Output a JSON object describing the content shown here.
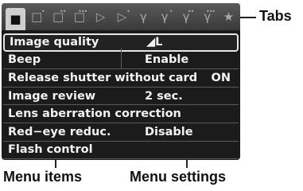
{
  "tabs": [
    {
      "icon": "camera-icon",
      "glyph": "■",
      "dots": ""
    },
    {
      "icon": "camera-icon",
      "glyph": "□",
      "dots": "•"
    },
    {
      "icon": "camera-icon",
      "glyph": "□",
      "dots": "••"
    },
    {
      "icon": "camera-icon",
      "glyph": "□",
      "dots": "•••"
    },
    {
      "icon": "playback-icon",
      "glyph": "▷",
      "dots": ""
    },
    {
      "icon": "playback-icon",
      "glyph": "▷",
      "dots": "•"
    },
    {
      "icon": "wrench-icon",
      "glyph": "γ",
      "dots": ""
    },
    {
      "icon": "wrench-icon",
      "glyph": "γ",
      "dots": "•"
    },
    {
      "icon": "wrench-icon",
      "glyph": "γ",
      "dots": "••"
    },
    {
      "icon": "wrench-icon",
      "glyph": "γ",
      "dots": "•••"
    },
    {
      "icon": "star-icon",
      "glyph": "★",
      "dots": ""
    }
  ],
  "menu": {
    "items": [
      {
        "label": "Image quality",
        "setting": "◢L",
        "selected": true
      },
      {
        "label": "Beep",
        "setting": "Enable"
      },
      {
        "label": "Release shutter without card",
        "setting": "ON"
      },
      {
        "label": "Image review",
        "setting": "2 sec."
      },
      {
        "label": "Lens aberration correction",
        "setting": ""
      },
      {
        "label": "Red−eye reduc.",
        "setting": "Disable"
      },
      {
        "label": "Flash control",
        "setting": ""
      }
    ]
  },
  "callouts": {
    "tabs": "Tabs",
    "menu_items": "Menu items",
    "menu_settings": "Menu settings"
  }
}
